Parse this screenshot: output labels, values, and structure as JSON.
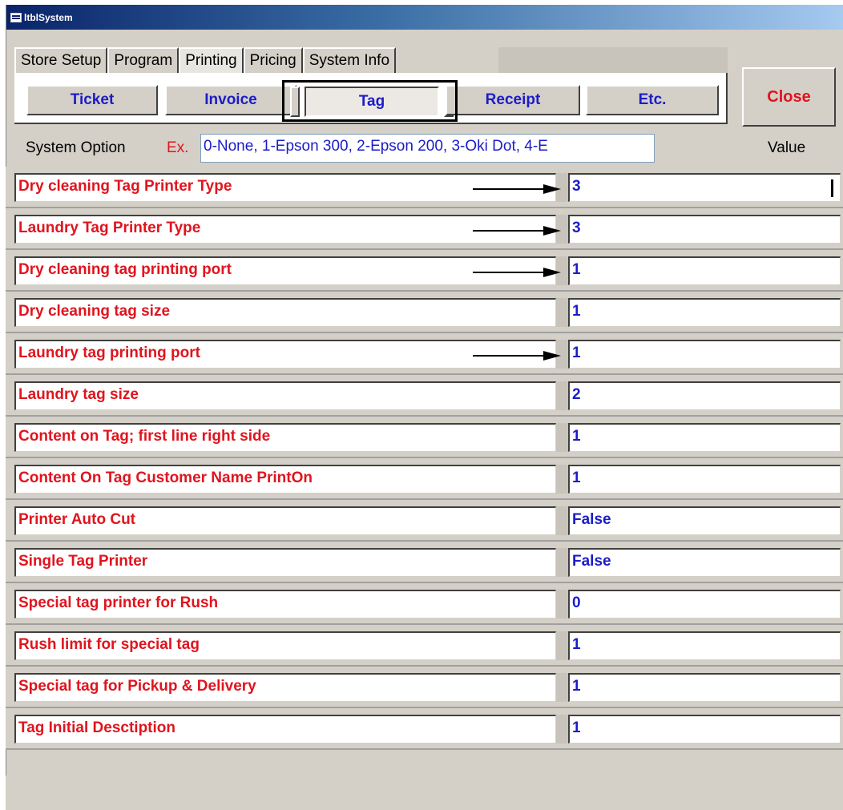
{
  "window": {
    "title": "ltblSystem"
  },
  "tabs": [
    {
      "label": "Store Setup"
    },
    {
      "label": "Program"
    },
    {
      "label": "Printing"
    },
    {
      "label": "Pricing"
    },
    {
      "label": "System Info"
    }
  ],
  "subtabs": [
    {
      "label": "Ticket"
    },
    {
      "label": "Invoice"
    },
    {
      "label": "Tag"
    },
    {
      "label": "Receipt"
    },
    {
      "label": "Etc."
    }
  ],
  "close_label": "Close",
  "system_option": {
    "label": "System Option",
    "ex_label": "Ex.",
    "example_value": "0-None, 1-Epson 300, 2-Epson 200, 3-Oki Dot, 4-E",
    "value_header": "Value"
  },
  "rows": [
    {
      "name": "Dry cleaning Tag Printer Type",
      "value": "3",
      "arrow": true
    },
    {
      "name": "Laundry Tag Printer Type",
      "value": "3",
      "arrow": true
    },
    {
      "name": "Dry cleaning tag printing port",
      "value": "1",
      "arrow": true
    },
    {
      "name": "Dry cleaning tag size",
      "value": "1",
      "arrow": false
    },
    {
      "name": "Laundry tag printing port",
      "value": "1",
      "arrow": true
    },
    {
      "name": "Laundry tag size",
      "value": "2",
      "arrow": false
    },
    {
      "name": "Content on Tag; first line right side",
      "value": "1",
      "arrow": false
    },
    {
      "name": "Content On Tag Customer Name PrintOn",
      "value": "1",
      "arrow": false
    },
    {
      "name": "Printer Auto Cut",
      "value": "False",
      "arrow": false
    },
    {
      "name": "Single Tag Printer",
      "value": "False",
      "arrow": false
    },
    {
      "name": "Special tag printer for Rush",
      "value": "0",
      "arrow": false
    },
    {
      "name": "Rush limit for special tag",
      "value": "1",
      "arrow": false
    },
    {
      "name": "Special tag for Pickup & Delivery",
      "value": "1",
      "arrow": false
    },
    {
      "name": "Tag Initial Desctiption",
      "value": "1",
      "arrow": false
    }
  ],
  "colors": {
    "label_red": "#e0141e",
    "value_blue": "#1c1cc8",
    "face": "#d4d0c8"
  }
}
